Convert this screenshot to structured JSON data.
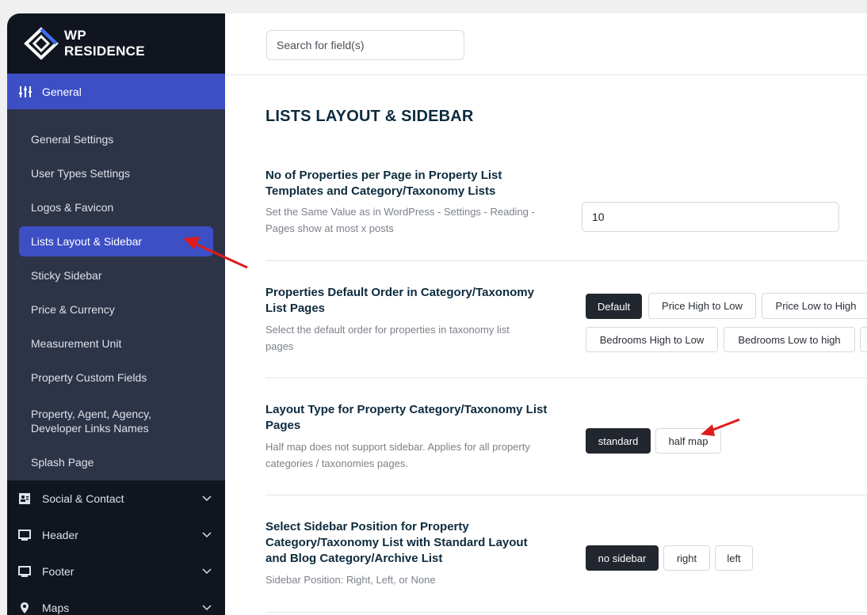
{
  "brand": {
    "line1": "WP",
    "line2": "RESIDENCE"
  },
  "sidebar": {
    "general_label": "General",
    "sub_items": [
      {
        "label": "General Settings"
      },
      {
        "label": "User Types Settings"
      },
      {
        "label": "Logos & Favicon"
      },
      {
        "label": "Lists Layout & Sidebar",
        "active": true
      },
      {
        "label": "Sticky Sidebar"
      },
      {
        "label": "Price & Currency"
      },
      {
        "label": "Measurement Unit"
      },
      {
        "label": "Property Custom Fields"
      },
      {
        "label_line1": "Property, Agent, Agency,",
        "label_line2": "Developer Links Names"
      },
      {
        "label": "Splash Page"
      }
    ],
    "sections": [
      {
        "label": "Social & Contact",
        "icon": "contact-card-icon"
      },
      {
        "label": "Header",
        "icon": "monitor-icon"
      },
      {
        "label": "Footer",
        "icon": "monitor-icon"
      },
      {
        "label": "Maps",
        "icon": "map-pin-icon"
      }
    ]
  },
  "search": {
    "placeholder": "Search for field(s)"
  },
  "page": {
    "title": "LISTS LAYOUT & SIDEBAR"
  },
  "settings": {
    "per_page": {
      "label_line1": "No of Properties per Page in Property List",
      "label_line2": "Templates and Category/Taxonomy Lists",
      "desc_line1": "Set the Same Value as in WordPress - Settings - Reading -",
      "desc_line2": "Pages show at most x posts",
      "value": "10"
    },
    "default_order": {
      "label_line1": "Properties Default Order in Category/Taxonomy",
      "label_line2": "List Pages",
      "desc_line1": "Select the default order for properties in taxonomy list",
      "desc_line2": "pages",
      "options": [
        "Default",
        "Price High to Low",
        "Price Low to High",
        "Bedrooms High to Low",
        "Bedrooms Low to high"
      ],
      "selected": "Default"
    },
    "layout_type": {
      "label_line1": "Layout Type for Property Category/Taxonomy List",
      "label_line2": "Pages",
      "desc_line1": "Half map does not support sidebar. Applies for all property",
      "desc_line2": "categories / taxonomies pages.",
      "options": [
        "standard",
        "half map"
      ],
      "selected": "standard"
    },
    "sidebar_position": {
      "label_line1": "Select Sidebar Position for Property",
      "label_line2": "Category/Taxonomy List with Standard Layout",
      "label_line3": "and Blog Category/Archive List",
      "desc_line1": "Sidebar Position: Right, Left, or None",
      "options": [
        "no sidebar",
        "right",
        "left"
      ],
      "selected": "no sidebar"
    }
  },
  "colors": {
    "accent": "#3c4fc5",
    "sidebar_bg": "#11151f",
    "submenu_bg": "#2d3448",
    "annotation_arrow": "#e01b1b"
  }
}
